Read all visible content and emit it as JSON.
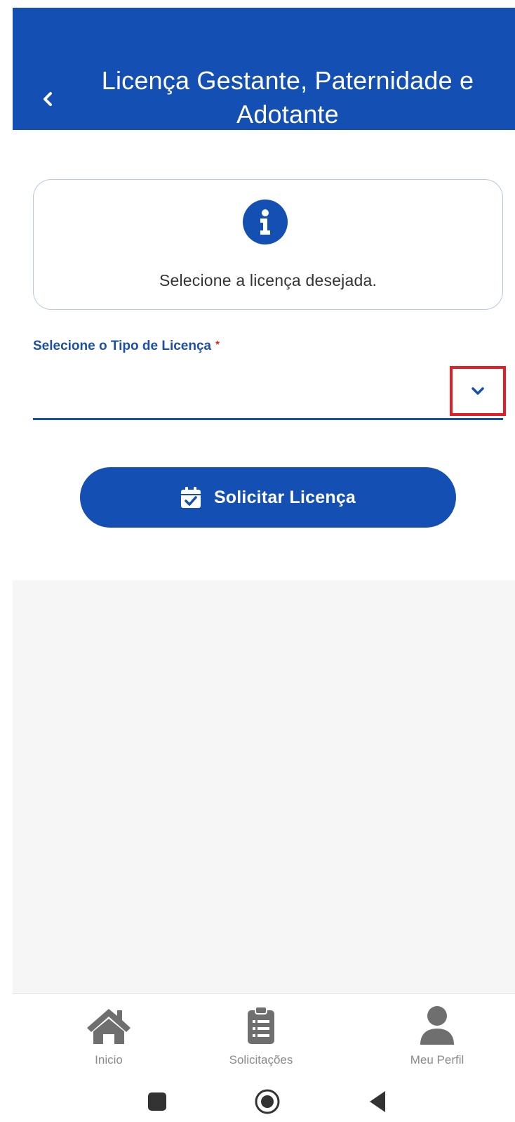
{
  "header": {
    "title": "Licença Gestante, Paternidade e Adotante",
    "back_icon": "chevron-left-icon"
  },
  "info_card": {
    "icon": "info-icon",
    "message": "Selecione a licença desejada."
  },
  "license_field": {
    "label": "Selecione o Tipo de Licença",
    "required_mark": "*",
    "value": "",
    "dropdown_icon": "chevron-down-icon"
  },
  "submit": {
    "icon": "calendar-check-icon",
    "label": "Solicitar Licença"
  },
  "bottom_nav": {
    "items": [
      {
        "label": "Inicio",
        "icon": "home-icon"
      },
      {
        "label": "Solicitações",
        "icon": "clipboard-list-icon"
      },
      {
        "label": "Meu Perfil",
        "icon": "user-icon"
      }
    ]
  },
  "system_nav": {
    "buttons": [
      "square-icon",
      "circle-icon",
      "triangle-back-icon"
    ]
  },
  "colors": {
    "primary": "#1450b4",
    "highlight": "#e41e26",
    "muted": "#8a8a8a",
    "background_grey": "#f6f6f6"
  }
}
